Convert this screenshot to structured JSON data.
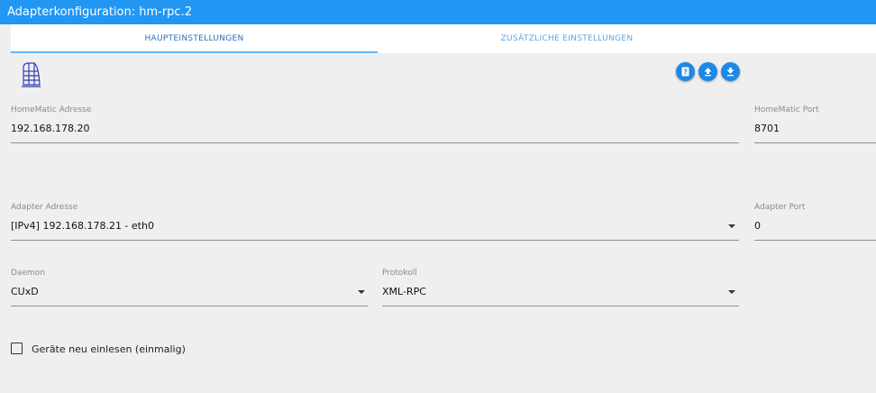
{
  "window": {
    "title": "Adapterkonfiguration: hm-rpc.2"
  },
  "tabs": [
    {
      "label": "HAUPTEINSTELLUNGEN",
      "active": true
    },
    {
      "label": "ZUSÄTZLICHE EINSTELLUNGEN",
      "active": false
    }
  ],
  "toolbar": {
    "buttons": [
      {
        "icon": "help-icon"
      },
      {
        "icon": "upload-icon"
      },
      {
        "icon": "download-icon"
      }
    ]
  },
  "form": {
    "homematic_address": {
      "label": "HomeMatic Adresse",
      "value": "192.168.178.20"
    },
    "homematic_port": {
      "label": "HomeMatic Port",
      "value": "8701"
    },
    "adapter_address": {
      "label": "Adapter Adresse",
      "value": "[IPv4] 192.168.178.21 - eth0"
    },
    "adapter_port": {
      "label": "Adapter Port",
      "value": "0"
    },
    "daemon": {
      "label": "Daemon",
      "value": "CUxD"
    },
    "protocol": {
      "label": "Protokoll",
      "value": "XML-RPC"
    },
    "reinit_checkbox": {
      "label": "Geräte neu einlesen (einmalig)",
      "checked": false
    }
  },
  "colors": {
    "accent": "#2196f3",
    "button": "#1e88e5"
  }
}
